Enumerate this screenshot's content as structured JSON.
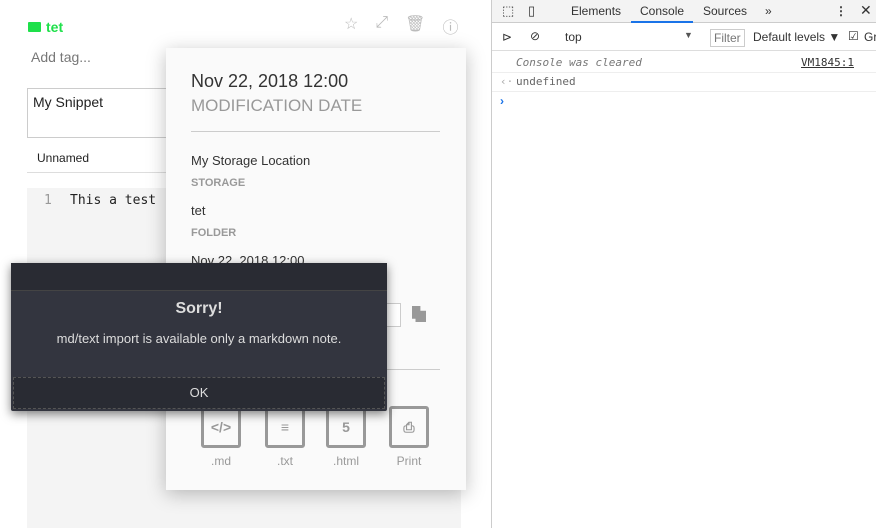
{
  "note": {
    "folder": "tet",
    "tag_placeholder": "Add tag...",
    "title": "My Snippet",
    "snippet_name": "Unnamed",
    "line_number": "1",
    "code": "This a test"
  },
  "toolbar": {
    "icons": [
      "star-icon",
      "fullscreen-icon",
      "trash-icon",
      "info-icon"
    ]
  },
  "info": {
    "modified": "Nov 22, 2018 12:00",
    "modified_label": "MODIFICATION DATE",
    "storage": "My Storage Location",
    "storage_label": "STORAGE",
    "folder": "tet",
    "folder_label": "FOLDER",
    "created": "Nov 22, 2018 12:00",
    "exports": [
      {
        "label": ".md",
        "glyph": "</>"
      },
      {
        "label": ".txt",
        "glyph": "≡"
      },
      {
        "label": ".html",
        "glyph": "5"
      },
      {
        "label": "Print",
        "glyph": "⎙"
      }
    ]
  },
  "dialog": {
    "title": "Sorry!",
    "message": "md/text import is available only a markdown note.",
    "ok": "OK"
  },
  "devtools": {
    "tabs": [
      "Elements",
      "Console",
      "Sources"
    ],
    "active_tab": "Console",
    "context": "top",
    "filter_placeholder": "Filter",
    "levels": "Default levels ▼",
    "group_label": "Gr",
    "messages": [
      {
        "text": "Console was cleared",
        "source": "VM1845:1"
      },
      {
        "text": "undefined"
      }
    ]
  },
  "colors": {
    "folder": "#1ee04a",
    "dialog_bg": "#33353f",
    "devtools_accent": "#1a73e8"
  }
}
